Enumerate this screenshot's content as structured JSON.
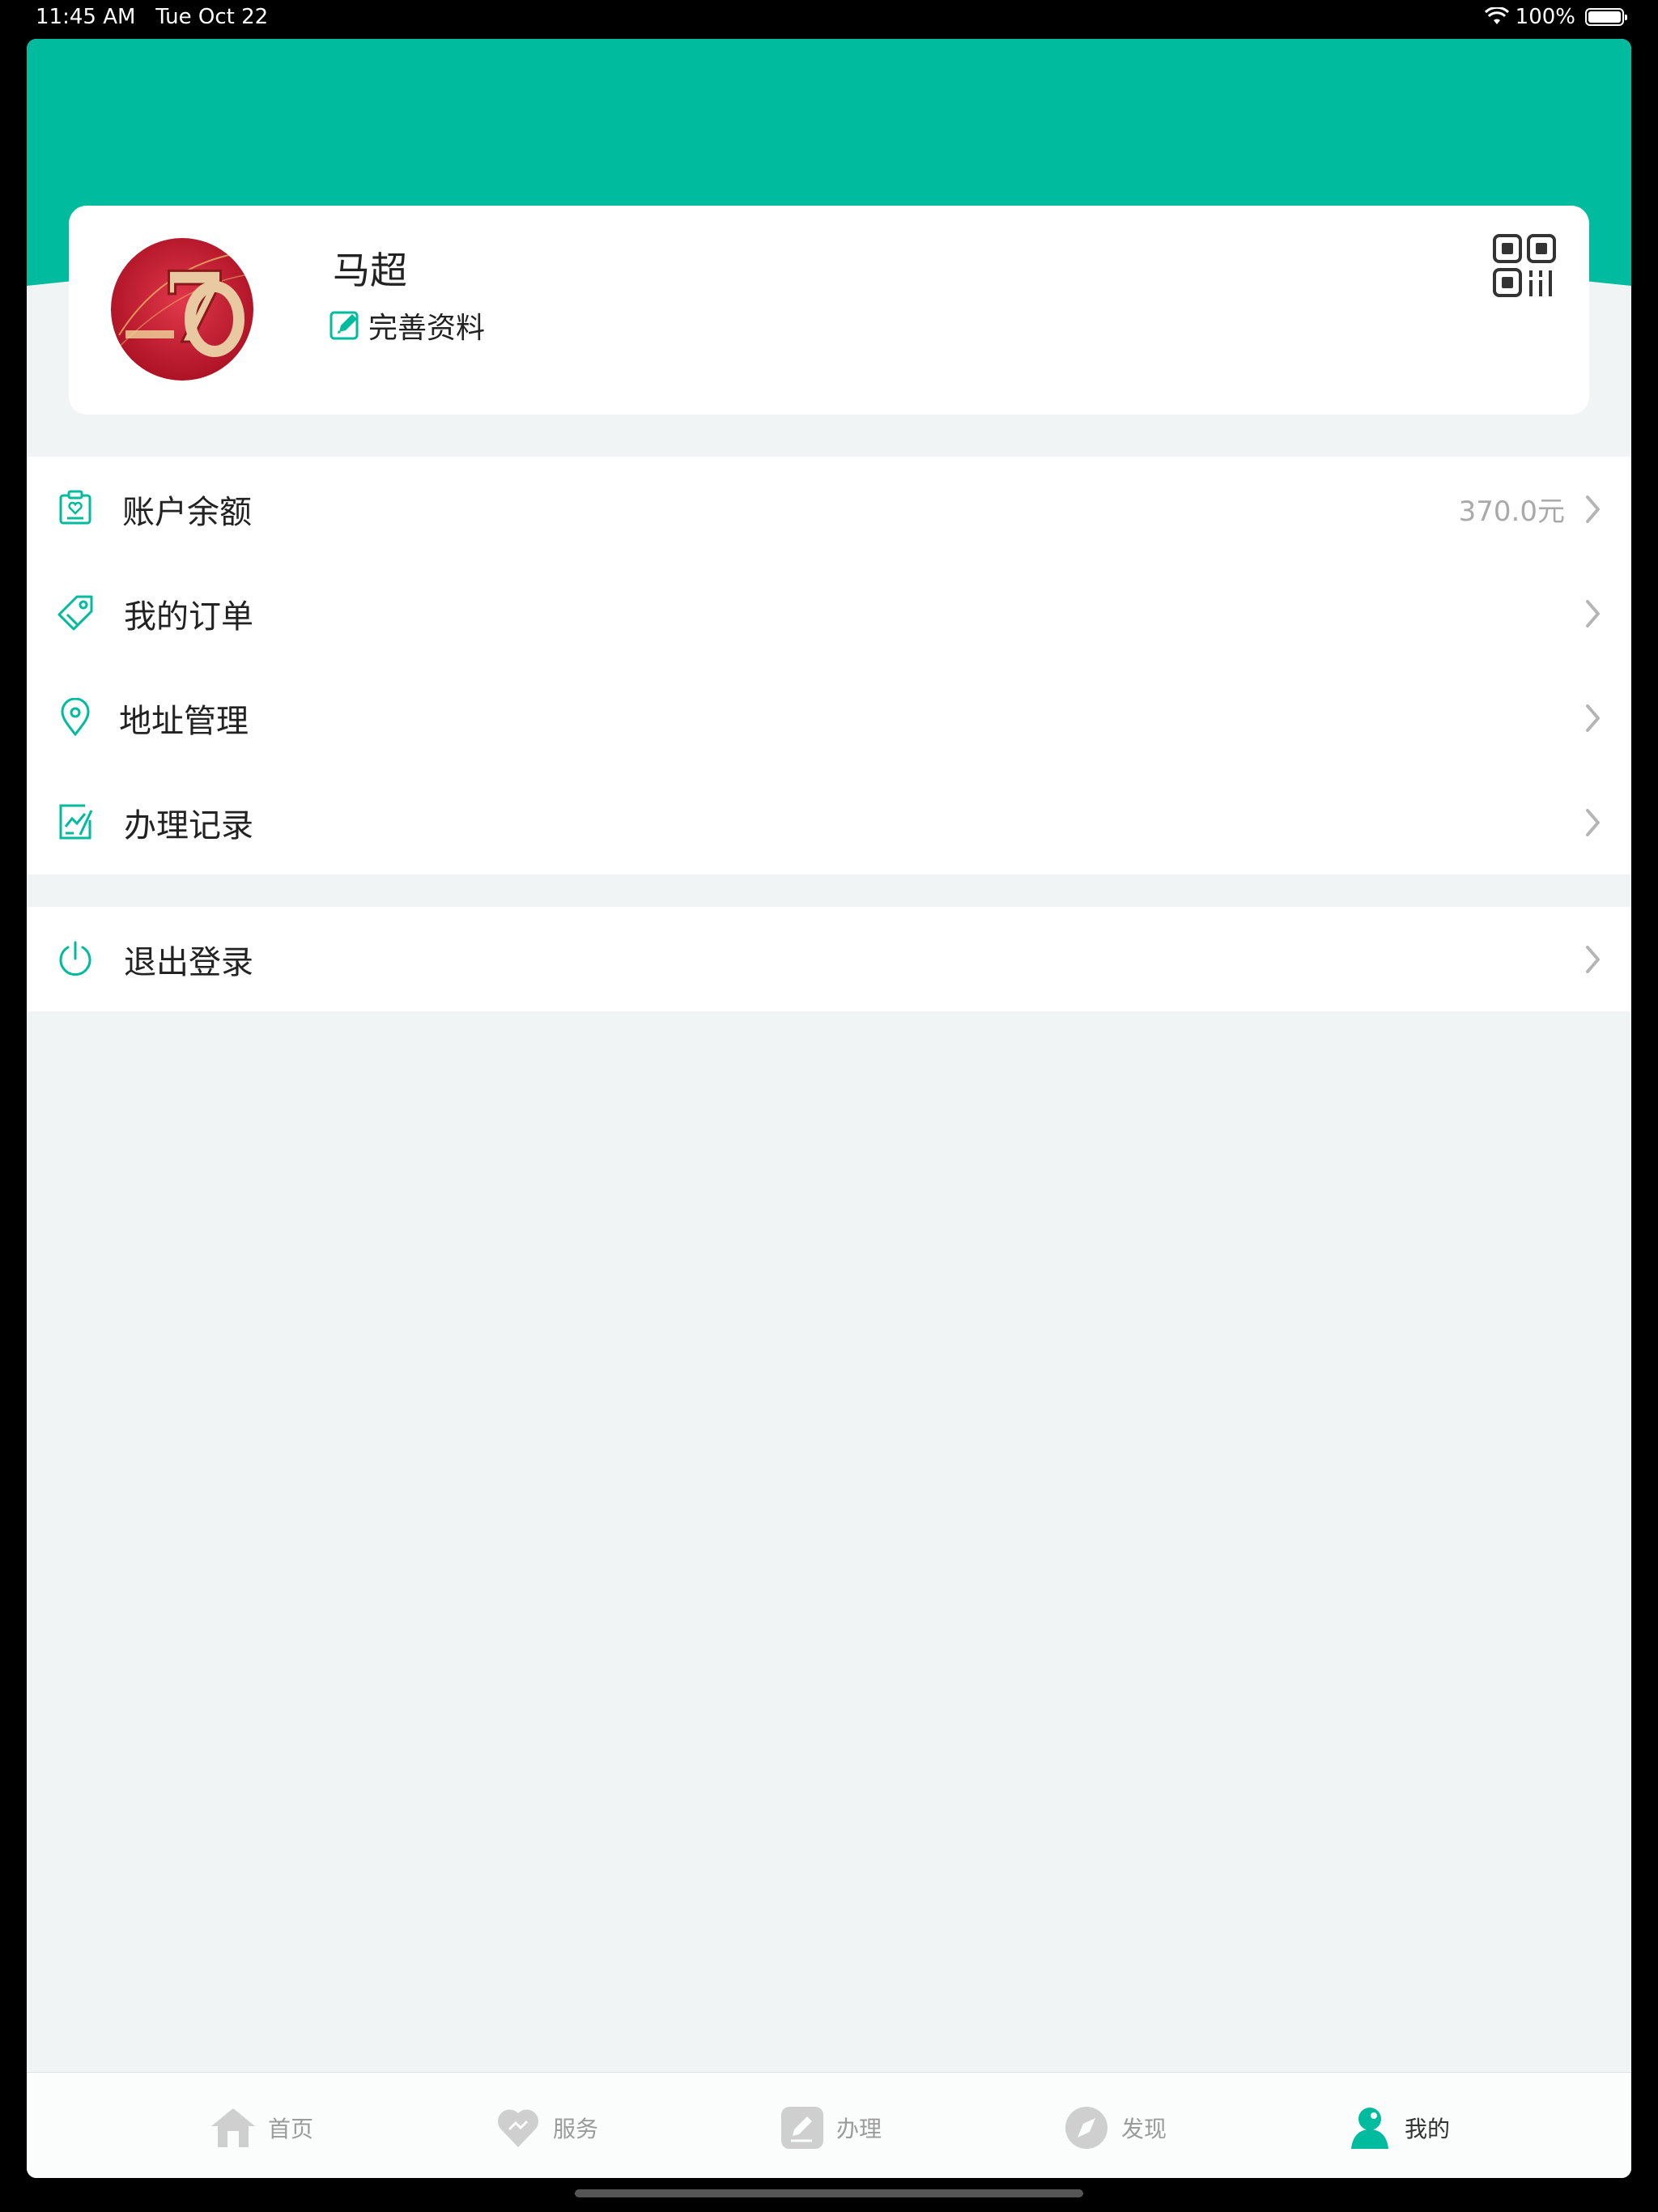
{
  "status_bar": {
    "time": "11:45 AM",
    "date": "Tue Oct 22",
    "battery": "100%"
  },
  "colors": {
    "accent": "#00bb9e",
    "background": "#f0f4f5",
    "text": "#222222",
    "muted": "#a9a9a9"
  },
  "profile": {
    "name": "马超",
    "edit_label": "完善资料"
  },
  "menu": {
    "items": [
      {
        "label": "账户余额",
        "value": "370.0元",
        "icon": "wallet-heart-icon"
      },
      {
        "label": "我的订单",
        "value": "",
        "icon": "tag-icon"
      },
      {
        "label": "地址管理",
        "value": "",
        "icon": "location-pin-icon"
      },
      {
        "label": "办理记录",
        "value": "",
        "icon": "record-chart-icon"
      }
    ],
    "logout": {
      "label": "退出登录",
      "icon": "power-icon"
    }
  },
  "tabs": [
    {
      "label": "首页",
      "icon": "home-icon",
      "active": false
    },
    {
      "label": "服务",
      "icon": "heart-icon",
      "active": false
    },
    {
      "label": "办理",
      "icon": "edit-icon",
      "active": false
    },
    {
      "label": "发现",
      "icon": "compass-icon",
      "active": false
    },
    {
      "label": "我的",
      "icon": "person-icon",
      "active": true
    }
  ]
}
